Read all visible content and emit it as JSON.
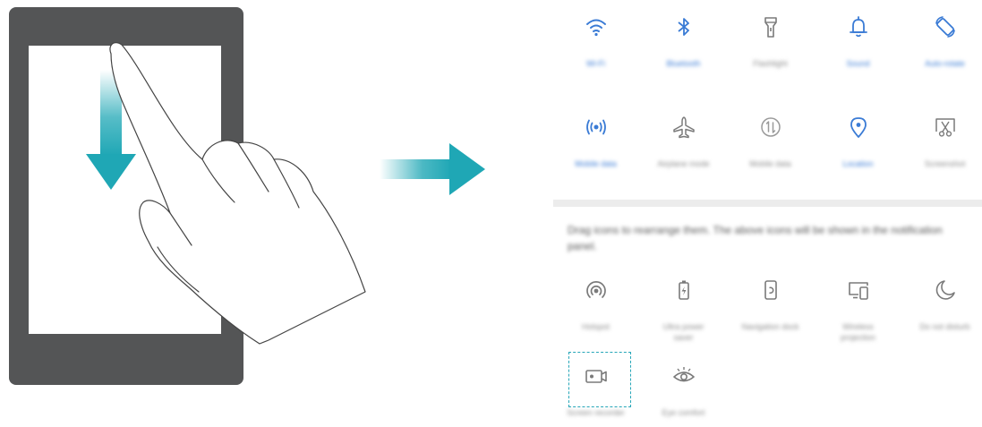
{
  "quick_settings": {
    "row1": [
      {
        "icon": "wifi-icon",
        "label": "Wi-Fi",
        "active": true
      },
      {
        "icon": "bluetooth-icon",
        "label": "Bluetooth",
        "active": true
      },
      {
        "icon": "flashlight-icon",
        "label": "Flashlight",
        "active": false
      },
      {
        "icon": "bell-icon",
        "label": "Sound",
        "active": true
      },
      {
        "icon": "auto-rotate-icon",
        "label": "Auto-rotate",
        "active": true
      }
    ],
    "row2": [
      {
        "icon": "mobile-data-icon",
        "label": "Mobile data",
        "active": true
      },
      {
        "icon": "airplane-icon",
        "label": "Airplane mode",
        "active": false
      },
      {
        "icon": "data-transfer-icon",
        "label": "Mobile data",
        "active": false
      },
      {
        "icon": "location-icon",
        "label": "Location",
        "active": true
      },
      {
        "icon": "screenshot-icon",
        "label": "Screenshot",
        "active": false
      }
    ],
    "hint": "Drag icons to rearrange them. The above icons will be shown in the notification panel.",
    "row3": [
      {
        "icon": "hotspot-icon",
        "label": "Hotspot",
        "label2": ""
      },
      {
        "icon": "battery-saver-icon",
        "label": "Ultra power",
        "label2": "saver"
      },
      {
        "icon": "navigation-dock-icon",
        "label": "Navigation dock",
        "label2": ""
      },
      {
        "icon": "wireless-projection-icon",
        "label": "Wireless",
        "label2": "projection"
      },
      {
        "icon": "moon-icon",
        "label": "Do not disturb",
        "label2": ""
      }
    ],
    "row4": [
      {
        "icon": "screen-recorder-icon",
        "label": "Screen recorder",
        "label2": ""
      },
      {
        "icon": "eye-comfort-icon",
        "label": "Eye comfort",
        "label2": ""
      }
    ]
  },
  "colors": {
    "tablet": "#545556",
    "arrow": "#1fa7b5",
    "icon_active": "#3a7bd5",
    "icon_inactive": "#7a7a7a"
  }
}
